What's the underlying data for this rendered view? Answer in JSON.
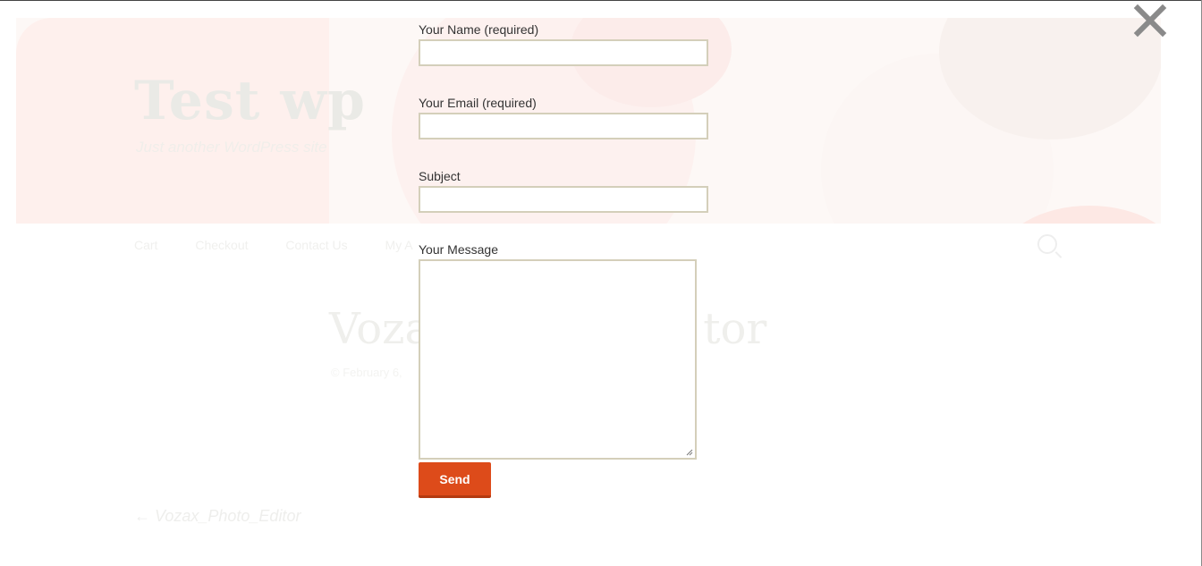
{
  "background_page": {
    "site_title": "Test wp",
    "site_tagline": "Just another WordPress site",
    "nav_items": [
      "Cart",
      "Checkout",
      "Contact Us",
      "My A"
    ],
    "post_title": "Voza                    tor",
    "post_meta": "© February 6,",
    "post_nav_link": "← Vozax_Photo_Editor"
  },
  "contact_form": {
    "name_label": "Your Name (required)",
    "name_value": "",
    "email_label": "Your Email (required)",
    "email_value": "",
    "subject_label": "Subject",
    "subject_value": "",
    "message_label": "Your Message",
    "message_value": "",
    "send_label": "Send"
  },
  "close_button": {
    "icon": "close-icon"
  },
  "colors": {
    "send_button": "#dd4b1a",
    "input_border": "#d4cfba",
    "close_icon": "#8a8a8a"
  }
}
